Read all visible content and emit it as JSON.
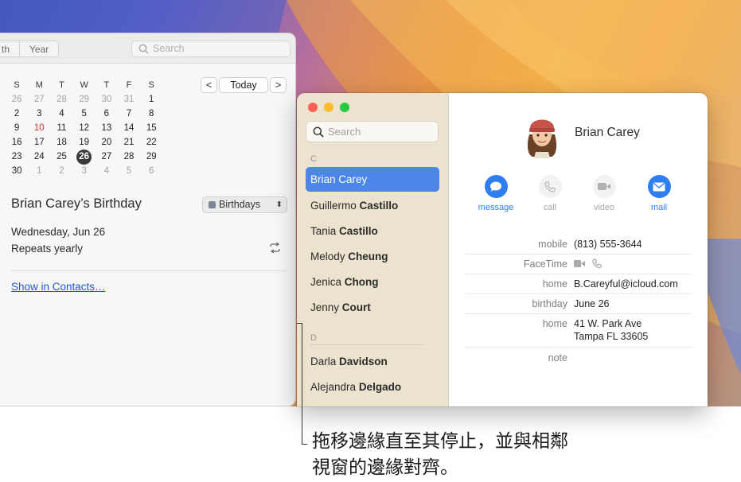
{
  "calendar": {
    "view_tabs": [
      "th",
      "Year"
    ],
    "search_placeholder": "Search",
    "weekdays": [
      "S",
      "M",
      "T",
      "W",
      "T",
      "F",
      "S"
    ],
    "weeks": [
      [
        "26",
        "27",
        "28",
        "29",
        "30",
        "31",
        "1"
      ],
      [
        "2",
        "3",
        "4",
        "5",
        "6",
        "7",
        "8"
      ],
      [
        "9",
        "10",
        "11",
        "12",
        "13",
        "14",
        "15"
      ],
      [
        "16",
        "17",
        "18",
        "19",
        "20",
        "21",
        "22"
      ],
      [
        "23",
        "24",
        "25",
        "26",
        "27",
        "28",
        "29"
      ],
      [
        "30",
        "1",
        "2",
        "3",
        "4",
        "5",
        "6"
      ]
    ],
    "prev_label": "<",
    "today_label": "Today",
    "next_label": ">",
    "event_title": "Brian Carey’s Birthday",
    "calendar_name": "Birthdays",
    "event_date": "Wednesday, Jun 26",
    "event_repeat": "Repeats yearly",
    "show_in_contacts": "Show in Contacts…"
  },
  "contacts": {
    "search_placeholder": "Search",
    "sections": [
      "C",
      "D"
    ],
    "list": [
      {
        "first": "Brian",
        "last": "Carey",
        "selected": true
      },
      {
        "first": "Guillermo",
        "last": "Castillo"
      },
      {
        "first": "Tania",
        "last": "Castillo"
      },
      {
        "first": "Melody",
        "last": "Cheung"
      },
      {
        "first": "Jenica",
        "last": "Chong"
      },
      {
        "first": "Jenny",
        "last": "Court"
      },
      {
        "first": "Darla",
        "last": "Davidson"
      },
      {
        "first": "Alejandra",
        "last": "Delgado"
      }
    ],
    "detail": {
      "name": "Brian Carey",
      "actions": [
        {
          "label": "message",
          "icon": "message-icon",
          "enabled": true
        },
        {
          "label": "call",
          "icon": "phone-icon",
          "enabled": false
        },
        {
          "label": "video",
          "icon": "video-icon",
          "enabled": false
        },
        {
          "label": "mail",
          "icon": "mail-icon",
          "enabled": true
        }
      ],
      "fields": {
        "mobile_label": "mobile",
        "mobile_value": "(813) 555-3644",
        "facetime_label": "FaceTime",
        "home_email_label": "home",
        "home_email_value": "B.Careyful@icloud.com",
        "birthday_label": "birthday",
        "birthday_value": "June 26",
        "home_address_label": "home",
        "address_line1": "41 W. Park Ave",
        "address_line2": "Tampa FL 33605",
        "note_label": "note"
      }
    }
  },
  "callout": {
    "line1": "拖移邊緣直至其停止，並與相鄰",
    "line2": "視窗的邊緣對齊。"
  },
  "colors": {
    "accent": "#2f7ef0",
    "selection": "#4d86e9",
    "sidebar": "#ece3cf",
    "holiday_red": "#d23b2a",
    "close": "#fe5f57",
    "minimize": "#febc2e",
    "zoom": "#28c840"
  }
}
